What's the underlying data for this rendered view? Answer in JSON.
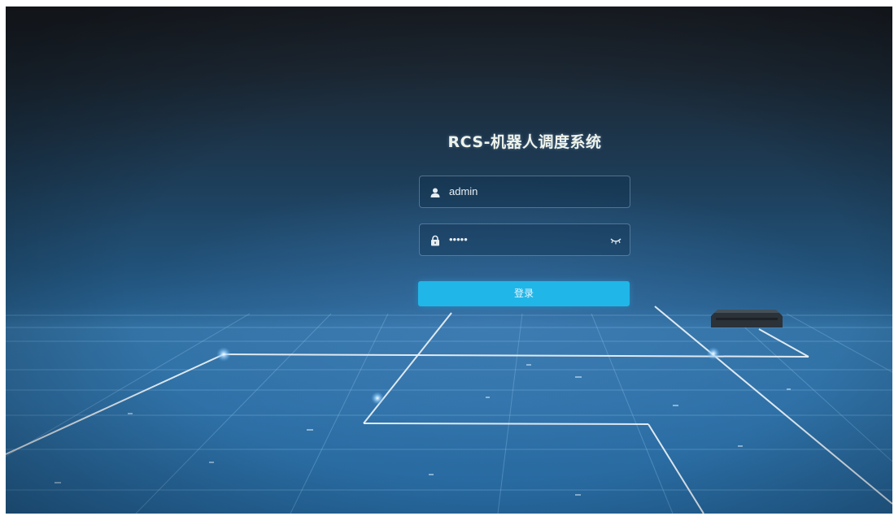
{
  "login": {
    "title": "RCS-机器人调度系统",
    "username_value": "admin",
    "password_value": "•••••",
    "submit_label": "登录"
  },
  "icons": {
    "username": "user-icon",
    "password": "lock-icon",
    "password_toggle": "eye-closed-icon"
  },
  "colors": {
    "button": "#21b6e8",
    "title_text": "#eef3ea",
    "background_top": "#1b1f26",
    "background_floor": "#27679c"
  }
}
